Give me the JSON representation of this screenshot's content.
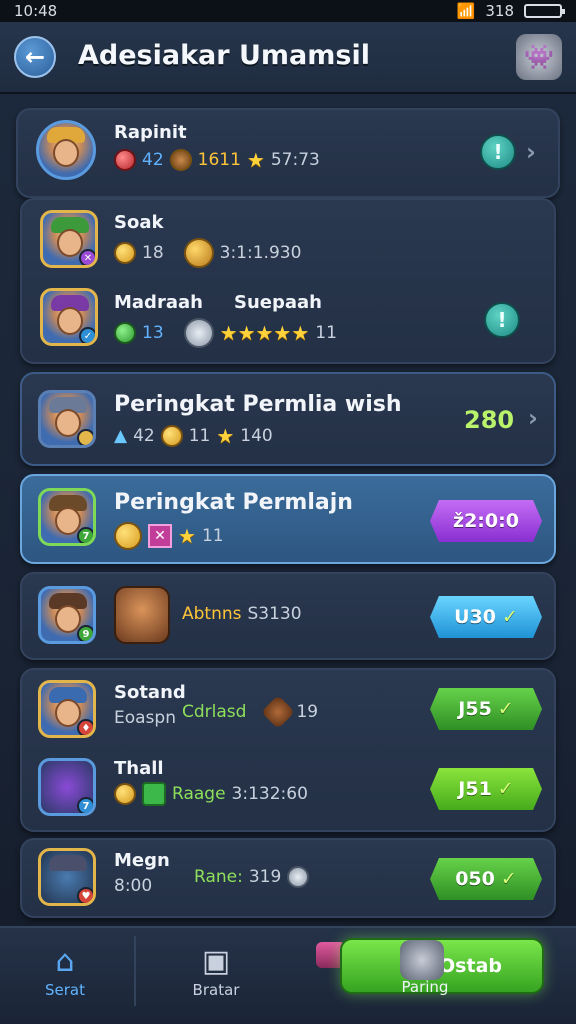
{
  "status": {
    "time": "10:48",
    "icons_left": "2",
    "signal": "318"
  },
  "header": {
    "title": "Adesiakar Umamsil",
    "back_icon": "arrow-left-icon"
  },
  "rows": [
    {
      "name": "Rapinit",
      "v1": "42",
      "v2": "1611",
      "v3": "57:73"
    },
    {
      "name": "Soak",
      "v1": "18",
      "v2": "3:1:1.930"
    },
    {
      "name": "Madraah",
      "v1": "13",
      "name2": "Suepaah",
      "v3": "11"
    },
    {
      "name": "Peringkat Permlia wish",
      "v1": "42",
      "v2": "11",
      "v3": "140",
      "score": "280"
    },
    {
      "name": "Peringkat Permlajn",
      "v3": "11",
      "pill": "ž2:0:0"
    },
    {
      "label": "Abtnns",
      "value": "S3130",
      "pill": "U30"
    },
    {
      "name": "Sotand",
      "sub": "Eoaspn",
      "label": "Cdrlasd",
      "v2": "19",
      "pill": "J55"
    },
    {
      "name": "Thall",
      "label": "Raage",
      "value": "3:132:60",
      "pill": "J51"
    },
    {
      "name": "Megn",
      "sub": "8:00",
      "label": "Rane:",
      "value": "319",
      "pill": "050"
    }
  ],
  "nav": {
    "home": "Serat",
    "mid": "Bratar",
    "play": "Paring",
    "play_btn": "2Ostab"
  }
}
